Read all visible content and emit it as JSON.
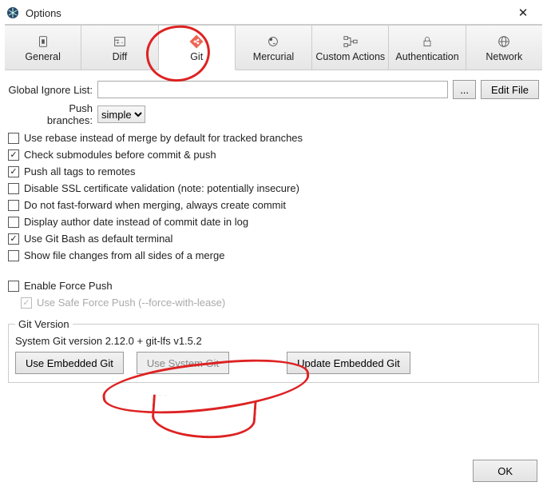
{
  "window": {
    "title": "Options"
  },
  "tabs": {
    "general": "General",
    "diff": "Diff",
    "git": "Git",
    "mercurial": "Mercurial",
    "custom": "Custom Actions",
    "auth": "Authentication",
    "network": "Network"
  },
  "ignore": {
    "label": "Global Ignore List:",
    "value": "",
    "browse": "...",
    "edit": "Edit File"
  },
  "push": {
    "label": "Push branches:",
    "value": "simple"
  },
  "checks": {
    "rebase": {
      "label": "Use rebase instead of merge by default for tracked branches",
      "checked": false
    },
    "submod": {
      "label": "Check submodules before commit & push",
      "checked": true
    },
    "tags": {
      "label": "Push all tags to remotes",
      "checked": true
    },
    "ssl": {
      "label": "Disable SSL certificate validation (note: potentially insecure)",
      "checked": false
    },
    "noff": {
      "label": "Do not fast-forward when merging, always create commit",
      "checked": false
    },
    "author": {
      "label": "Display author date instead of commit date in log",
      "checked": false
    },
    "bash": {
      "label": "Use Git Bash as default terminal",
      "checked": true
    },
    "sides": {
      "label": "Show file changes from all sides of a merge",
      "checked": false
    },
    "force": {
      "label": "Enable Force Push",
      "checked": false
    },
    "safeforce": {
      "label": "Use Safe Force Push (--force-with-lease)",
      "checked": true
    }
  },
  "gitversion": {
    "legend": "Git Version",
    "text": "System Git version 2.12.0 + git-lfs v1.5.2",
    "embedded": "Use Embedded Git",
    "system": "Use System Git",
    "update": "Update Embedded Git"
  },
  "footer": {
    "ok": "OK"
  }
}
